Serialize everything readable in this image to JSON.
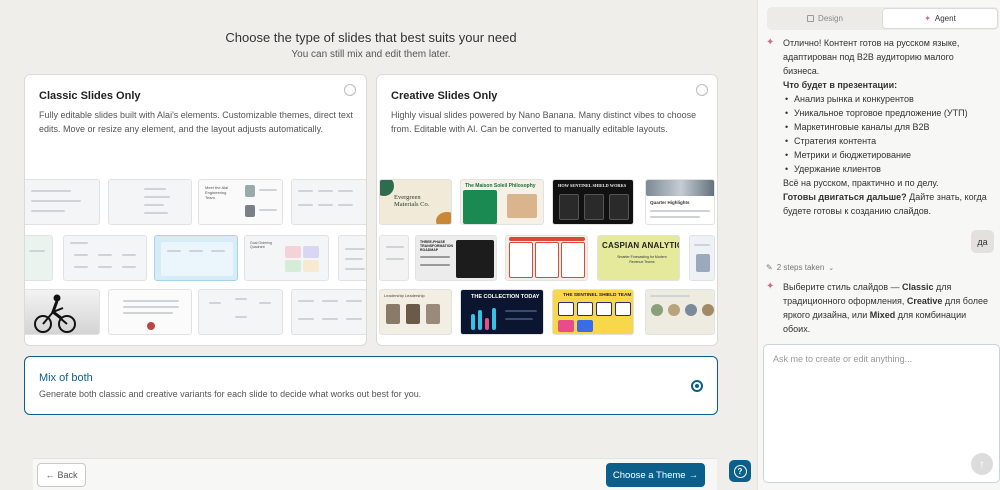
{
  "header": {
    "title": "Choose the type of slides that best suits your need",
    "subtitle": "You can still mix and edit them later."
  },
  "options": {
    "classic": {
      "title": "Classic Slides Only",
      "description": "Fully editable slides built with Alai's elements. Customizable themes, direct text edits. Move or resize any element, and the layout adjusts automatically."
    },
    "creative": {
      "title": "Creative Slides Only",
      "description": "Highly visual slides powered by Nano Banana. Many distinct vibes to choose from. Editable with AI. Can be converted to manually editable layouts."
    },
    "mix": {
      "title": "Mix of both",
      "description": "Generate both classic and creative variants for each slide to decide what works out best for you."
    }
  },
  "thumbnails": {
    "evergreen": "Evergreen Materials Co.",
    "maison": "The Maison Soleil Philosophy",
    "sentinel_works": "HOW SENTINEL SHIELD WORKS",
    "quarter": "Quarter Highlights",
    "three_phase": "THREE-PHASE TRANSFORMATION ROADMAP",
    "caspian": "CASPIAN ANALYTICS",
    "caspian_sub": "Smarter Forecasting for Modern Revenue Teams",
    "leadership": "Leadership Leadership",
    "collection": "THE COLLECTION TODAY",
    "sentinel_team": "THE SENTINEL SHIELD TEAM",
    "classic_team": "Meet the Alai Engineering Team",
    "classic_matrix": "Goal Ordering Quadrant"
  },
  "footer": {
    "back_label": "Back",
    "theme_label": "Choose a Theme",
    "help_label": "?"
  },
  "panel": {
    "tabs": [
      {
        "label": "Design",
        "icon": "design-icon"
      },
      {
        "label": "Agent",
        "icon": "sparkle-icon"
      }
    ],
    "agent_message_1": {
      "intro": "Отлично! Контент готов на русском языке, адаптирован под B2B аудиторию малого бизнеса.",
      "list_heading": "Что будет в презентации:",
      "items": [
        "Анализ рынка и конкурентов",
        "Уникальное торговое предложение (УТП)",
        "Маркетинговые каналы для B2B",
        "Стратегия контента",
        "Метрики и бюджетирование",
        "Удержание клиентов"
      ],
      "outro_plain": "Всё на русском, практично и по делу.",
      "outro_bold": "Готовы двигаться дальше?",
      "outro_rest": "Дайте знать, когда будете готовы к созданию слайдов."
    },
    "user_reply": "да",
    "steps_label": "2 steps taken",
    "agent_message_2": {
      "p1": "Выберите стиль слайдов — ",
      "b1": "Classic",
      "p2": " для традиционного оформления, ",
      "b2": "Creative",
      "p3": " для более яркого дизайна, или ",
      "b3": "Mixed",
      "p4": " для комбинации обоих."
    },
    "input_placeholder": "Ask me to create or edit anything..."
  },
  "colors": {
    "accent": "#0c5f8a",
    "sparkle": "#d46a8a"
  }
}
